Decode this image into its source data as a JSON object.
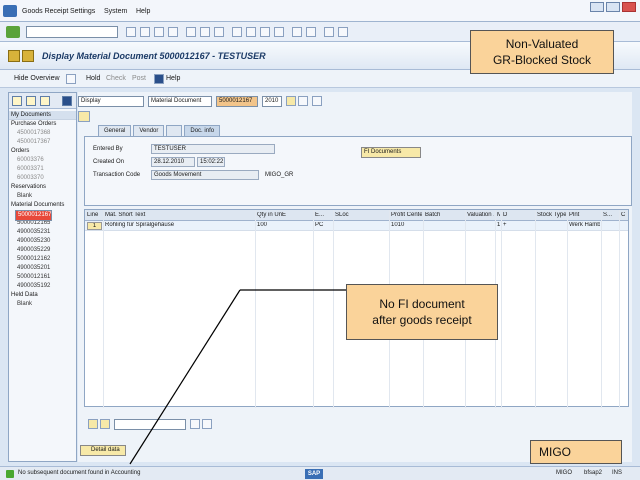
{
  "menu": {
    "items": [
      "Goods Receipt",
      "Settings",
      "System",
      "Help"
    ]
  },
  "title": "Display Material Document 5000012167 - TESTUSER",
  "app_toolbar": {
    "hide_overview": "Hide Overview",
    "hold": "Hold",
    "check": "Check",
    "post": "Post",
    "help": "Help"
  },
  "callouts": {
    "top_right_line1": "Non-Valuated",
    "top_right_line2": "GR-Blocked Stock",
    "middle_line1": "No FI document",
    "middle_line2": "after goods receipt",
    "bottom_right": "MIGO"
  },
  "left_panel": {
    "header": "My Documents",
    "groups": [
      {
        "label": "Purchase Orders",
        "items": [
          "4500017368",
          "4500017367"
        ],
        "dim": true
      },
      {
        "label": "Orders",
        "items": [
          "60003376",
          "60003371",
          "60003370"
        ],
        "dim": true
      },
      {
        "label": "Reservations",
        "items": [
          "Blank"
        ],
        "dim": false
      },
      {
        "label": "Material Documents",
        "items": [
          "5000012167",
          "5000012166",
          "5000012165",
          "4900035231",
          "4900035230",
          "4900035229",
          "5000012162",
          "4900035201",
          "5000012161",
          "4900035192"
        ],
        "dim": false,
        "selected_index": 0
      },
      {
        "label": "Held Data",
        "items": [
          "Blank"
        ],
        "dim": false
      }
    ]
  },
  "header_row": {
    "action": "Display",
    "reference": "Material Document",
    "doc_number": "5000012167",
    "year": "2010"
  },
  "tabs": [
    "General",
    "Vendor",
    "Doc. info"
  ],
  "doc_info": {
    "entered_by_label": "Entered By",
    "entered_by": "TESTUSER",
    "created_on_label": "Created On",
    "created_date": "28.12.2010",
    "created_time": "15:02:22",
    "tcode_label": "Transaction Code",
    "tcode_desc": "Goods Movement",
    "tcode": "MIGO_GR",
    "fi_button": "FI Documents"
  },
  "grid": {
    "columns": [
      "Line",
      "Mat. Short Text",
      "Qty in UnE",
      "E...",
      "SLoc",
      "Profit Center",
      "Batch",
      "Valuation ...",
      "M...",
      "D",
      "Stock Type",
      "Plnt",
      "S...",
      "C"
    ],
    "rows": [
      [
        "1",
        "Rohling für Spiralgehäuse",
        "100",
        "PC",
        "",
        "1010",
        "",
        "",
        "103",
        "+",
        "",
        "Werk Hamb...",
        "",
        ""
      ]
    ]
  },
  "detail_button": "Detail data",
  "status": {
    "message": "No subsequent document found in Accounting",
    "sap": "SAP",
    "tcode": "MIGO",
    "server": "bfsap2",
    "mode": "INS"
  }
}
